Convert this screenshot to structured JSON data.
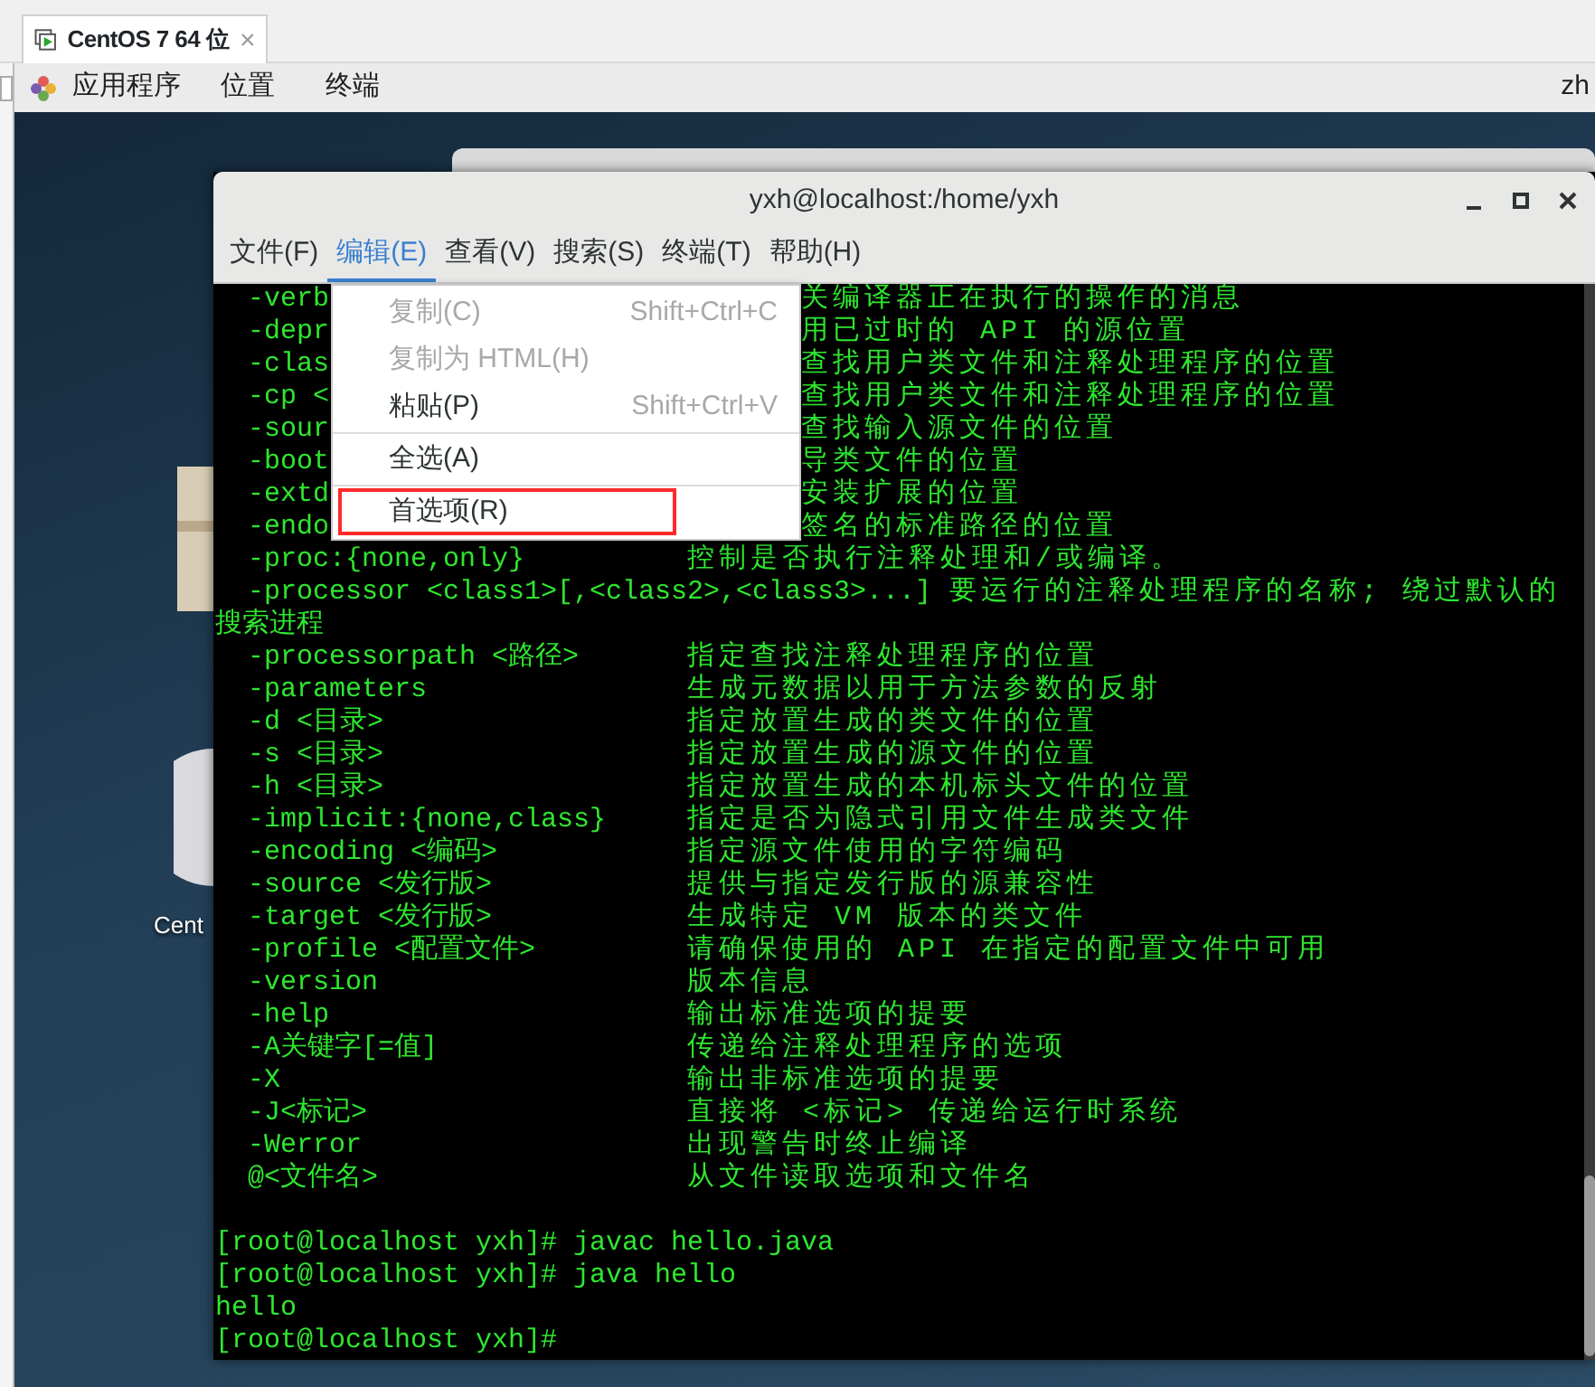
{
  "vm_tab": {
    "title": "CentOS 7 64 位",
    "close": "×"
  },
  "top_bar": {
    "menus": [
      "应用程序",
      "位置",
      "终端"
    ],
    "input_method": "zh"
  },
  "desktop": {
    "icon_label": "Cent"
  },
  "terminal": {
    "title": "yxh@localhost:/home/yxh",
    "menu": [
      {
        "label": "文件(F)",
        "selected": false
      },
      {
        "label": "编辑(E)",
        "selected": true
      },
      {
        "label": "查看(V)",
        "selected": false
      },
      {
        "label": "搜索(S)",
        "selected": false
      },
      {
        "label": "终端(T)",
        "selected": false
      },
      {
        "label": "帮助(H)",
        "selected": false
      }
    ],
    "lines": [
      {
        "kind": "partial",
        "option": "-verb",
        "description": "关编译器正在执行的操作的消息"
      },
      {
        "kind": "partial",
        "option": "-depr",
        "description": "用已过时的 API 的源位置"
      },
      {
        "kind": "partial",
        "option": "-clas",
        "description": "查找用户类文件和注释处理程序的位置"
      },
      {
        "kind": "partial",
        "option": "-cp <",
        "description": "查找用户类文件和注释处理程序的位置"
      },
      {
        "kind": "partial",
        "option": "-sour",
        "description": "查找输入源文件的位置"
      },
      {
        "kind": "partial",
        "option": "-boot",
        "description": "导类文件的位置"
      },
      {
        "kind": "partial",
        "option": "-extd",
        "description": "安装扩展的位置"
      },
      {
        "kind": "partial",
        "option": "-endo",
        "description": "签名的标准路径的位置"
      },
      {
        "kind": "option",
        "option": "-proc:{none,only}",
        "description": "控制是否执行注释处理和/或编译。"
      },
      {
        "kind": "inline",
        "option": "-processor <class1>[,<class2>,<class3>...]",
        "description": "要运行的注释处理程序的名称; 绕过默认的"
      },
      {
        "kind": "plain",
        "text": "搜索进程"
      },
      {
        "kind": "option",
        "option": "-processorpath <路径>",
        "description": "指定查找注释处理程序的位置"
      },
      {
        "kind": "option",
        "option": "-parameters",
        "description": "生成元数据以用于方法参数的反射"
      },
      {
        "kind": "option",
        "option": "-d <目录>",
        "description": "指定放置生成的类文件的位置"
      },
      {
        "kind": "option",
        "option": "-s <目录>",
        "description": "指定放置生成的源文件的位置"
      },
      {
        "kind": "option",
        "option": "-h <目录>",
        "description": "指定放置生成的本机标头文件的位置"
      },
      {
        "kind": "option",
        "option": "-implicit:{none,class}",
        "description": "指定是否为隐式引用文件生成类文件"
      },
      {
        "kind": "option",
        "option": "-encoding <编码>",
        "description": "指定源文件使用的字符编码"
      },
      {
        "kind": "option",
        "option": "-source <发行版>",
        "description": "提供与指定发行版的源兼容性"
      },
      {
        "kind": "option",
        "option": "-target <发行版>",
        "description": "生成特定 VM 版本的类文件"
      },
      {
        "kind": "option",
        "option": "-profile <配置文件>",
        "description": "请确保使用的 API 在指定的配置文件中可用"
      },
      {
        "kind": "option",
        "option": "-version",
        "description": "版本信息"
      },
      {
        "kind": "option",
        "option": "-help",
        "description": "输出标准选项的提要"
      },
      {
        "kind": "option",
        "option": "-A关键字[=值]",
        "description": "传递给注释处理程序的选项"
      },
      {
        "kind": "option",
        "option": "-X",
        "description": "输出非标准选项的提要"
      },
      {
        "kind": "option",
        "option": "-J<标记>",
        "description": "直接将 <标记> 传递给运行时系统"
      },
      {
        "kind": "option",
        "option": "-Werror",
        "description": "出现警告时终止编译"
      },
      {
        "kind": "option",
        "option": "@<文件名>",
        "description": "从文件读取选项和文件名"
      },
      {
        "kind": "blank"
      },
      {
        "kind": "plain",
        "text": "[root@localhost yxh]# javac hello.java"
      },
      {
        "kind": "plain",
        "text": "[root@localhost yxh]# java hello"
      },
      {
        "kind": "plain",
        "text": "hello"
      },
      {
        "kind": "plain",
        "text": "[root@localhost yxh]#"
      }
    ]
  },
  "edit_menu": {
    "items": [
      {
        "kind": "item",
        "label": "复制(C)",
        "shortcut": "Shift+Ctrl+C",
        "disabled": true,
        "annotated": false
      },
      {
        "kind": "item",
        "label": "复制为 HTML(H)",
        "disabled": true,
        "annotated": false
      },
      {
        "kind": "item",
        "label": "粘贴(P)",
        "shortcut": "Shift+Ctrl+V",
        "disabled": false,
        "annotated": false
      },
      {
        "kind": "separator"
      },
      {
        "kind": "item",
        "label": "全选(A)",
        "disabled": false,
        "annotated": false
      },
      {
        "kind": "separator"
      },
      {
        "kind": "item",
        "label": "首选项(R)",
        "disabled": false,
        "annotated": true
      }
    ]
  }
}
